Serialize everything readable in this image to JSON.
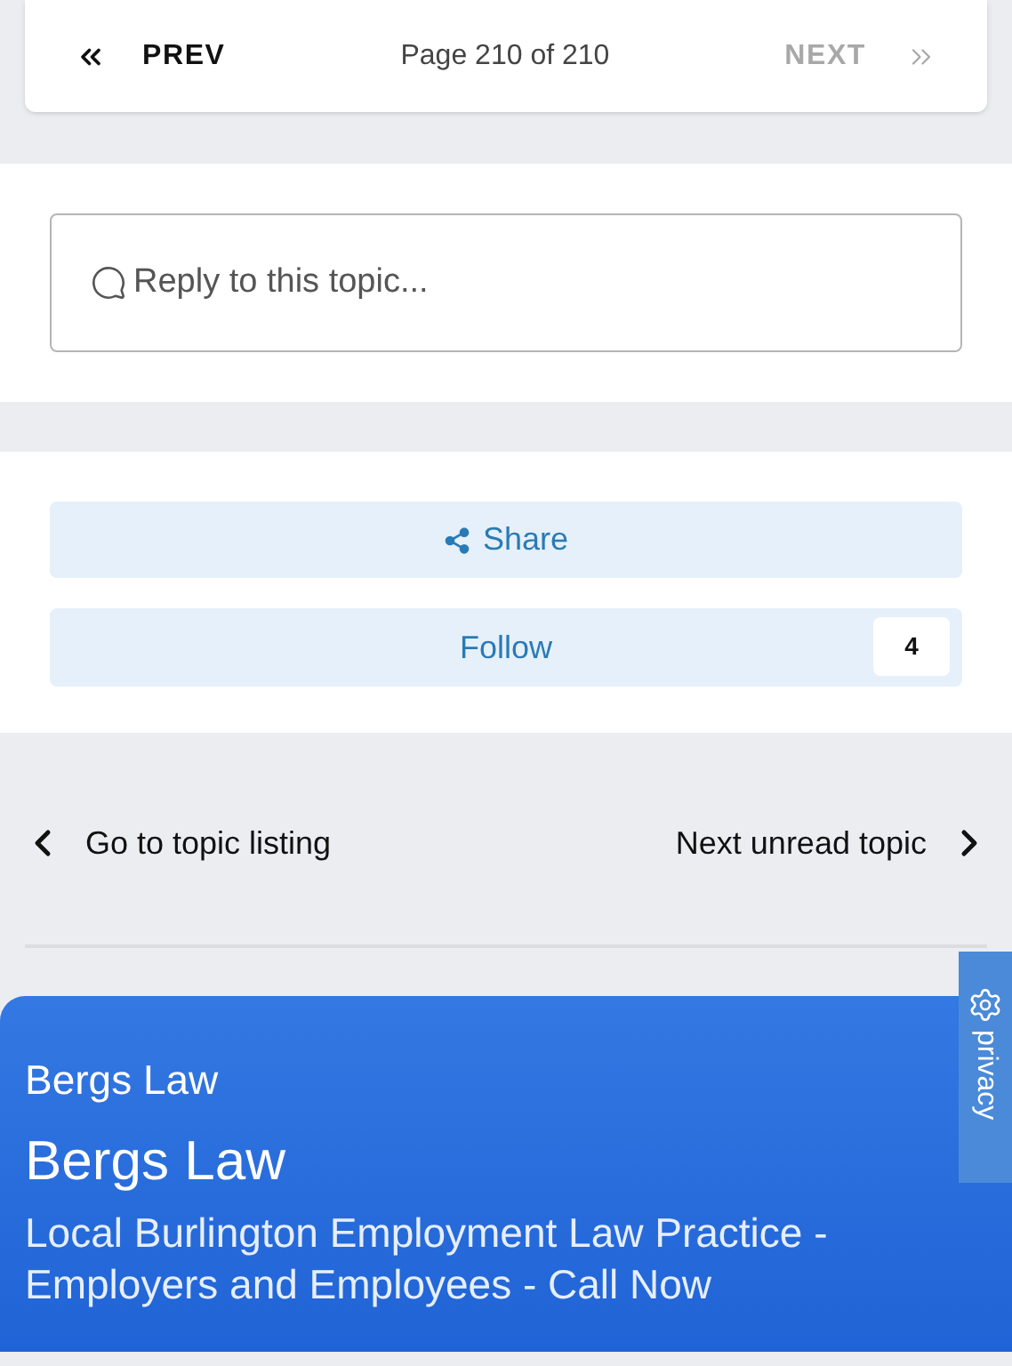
{
  "pagination": {
    "prev": {
      "label": "PREV",
      "disabled": false
    },
    "page_info": "Page 210 of 210",
    "next": {
      "label": "NEXT",
      "disabled": true
    }
  },
  "reply": {
    "placeholder": "Reply to this topic..."
  },
  "actions": {
    "share": {
      "label": "Share"
    },
    "follow": {
      "label": "Follow",
      "count": "4"
    }
  },
  "topic_nav": {
    "back": "Go to topic listing",
    "next": "Next unread topic"
  },
  "ad": {
    "advertiser": "Bergs Law",
    "headline": "Bergs Law",
    "description": "Local Burlington Employment Law Practice - Employers and Employees - Call Now"
  },
  "privacy_tab": {
    "label": "privacy"
  }
}
